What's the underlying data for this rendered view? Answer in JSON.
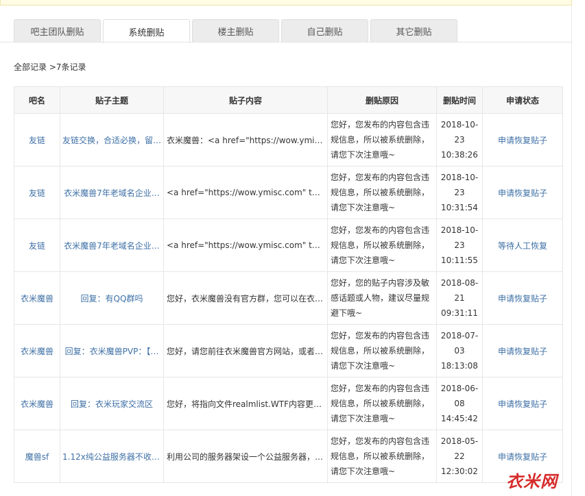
{
  "tabs": [
    {
      "label": "吧主团队删贴",
      "active": false
    },
    {
      "label": "系统删贴",
      "active": true
    },
    {
      "label": "楼主删贴",
      "active": false
    },
    {
      "label": "自己删贴",
      "active": false
    },
    {
      "label": "其它删贴",
      "active": false
    }
  ],
  "breadcrumb": {
    "root": "全部记录",
    "sep": " >",
    "count": "7条记录"
  },
  "table": {
    "headers": {
      "bar": "吧名",
      "title": "贴子主题",
      "content": "贴子内容",
      "reason": "删贴原因",
      "time": "删贴时间",
      "status": "申请状态"
    },
    "rows": [
      {
        "bar": "友链",
        "title": "友链交换，合适必换，留…",
        "content": "衣米魔兽：<a href=\"https://wow.ymisc.co…",
        "reason": "您好，您发布的内容包含违规信息，所以被系统删除，请您下次注意哦~",
        "date": "2018-10-23",
        "time": "10:38:26",
        "status": "申请恢复贴子"
      },
      {
        "bar": "友链",
        "title": "衣米魔兽7年老域名企业…",
        "content": "<a href=\"https://wow.ymisc.com\" target=\"_…",
        "reason": "您好，您发布的内容包含违规信息，所以被系统删除，请您下次注意哦~",
        "date": "2018-10-23",
        "time": "10:31:54",
        "status": "申请恢复贴子"
      },
      {
        "bar": "友链",
        "title": "衣米魔兽7年老域名企业…",
        "content": "<a href=\"https://wow.ymisc.com\" target=\"_…",
        "reason": "您好，您发布的内容包含违规信息，所以被系统删除，请您下次注意哦~",
        "date": "2018-10-23",
        "time": "10:11:55",
        "status": "等待人工恢复"
      },
      {
        "bar": "衣米魔兽",
        "title": "回复：有QQ群吗",
        "content": "您好，衣米魔兽没有官方群，您可以在衣…",
        "reason": "您好，您的贴子内容涉及敏感话题或人物，建议尽量规避下哦~",
        "date": "2018-08-21",
        "time": "09:31:11",
        "status": "申请恢复贴子"
      },
      {
        "bar": "衣米魔兽",
        "title": "回复：衣米魔兽PVP：【…",
        "content": "您好，请您前往衣米魔兽官方网站，或者…",
        "reason": "您好，您发布的内容包含违规信息，所以被系统删除，请您下次注意哦~",
        "date": "2018-07-03",
        "time": "18:13:08",
        "status": "申请恢复贴子"
      },
      {
        "bar": "衣米魔兽",
        "title": "回复：衣米玩家交流区",
        "content": "您好，将指向文件realmlist.WTF内容更改…",
        "reason": "您好，您发布的内容包含违规信息，所以被系统删除，请您下次注意哦~",
        "date": "2018-06-08",
        "time": "14:45:42",
        "status": "申请恢复贴子"
      },
      {
        "bar": "魔兽sf",
        "title": "1.12x纯公益服务器不收取…",
        "content": "利用公司的服务器架设一个公益服务器，…",
        "reason": "您好，您发布的内容包含违规信息，所以被系统删除，请您下次注意哦~",
        "date": "2018-05-22",
        "time": "12:30:02",
        "status": "申请恢复贴子"
      }
    ]
  },
  "watermark": "衣米网",
  "colors": {
    "link": "#3d6fa5",
    "watermark": "#d62b2b"
  }
}
